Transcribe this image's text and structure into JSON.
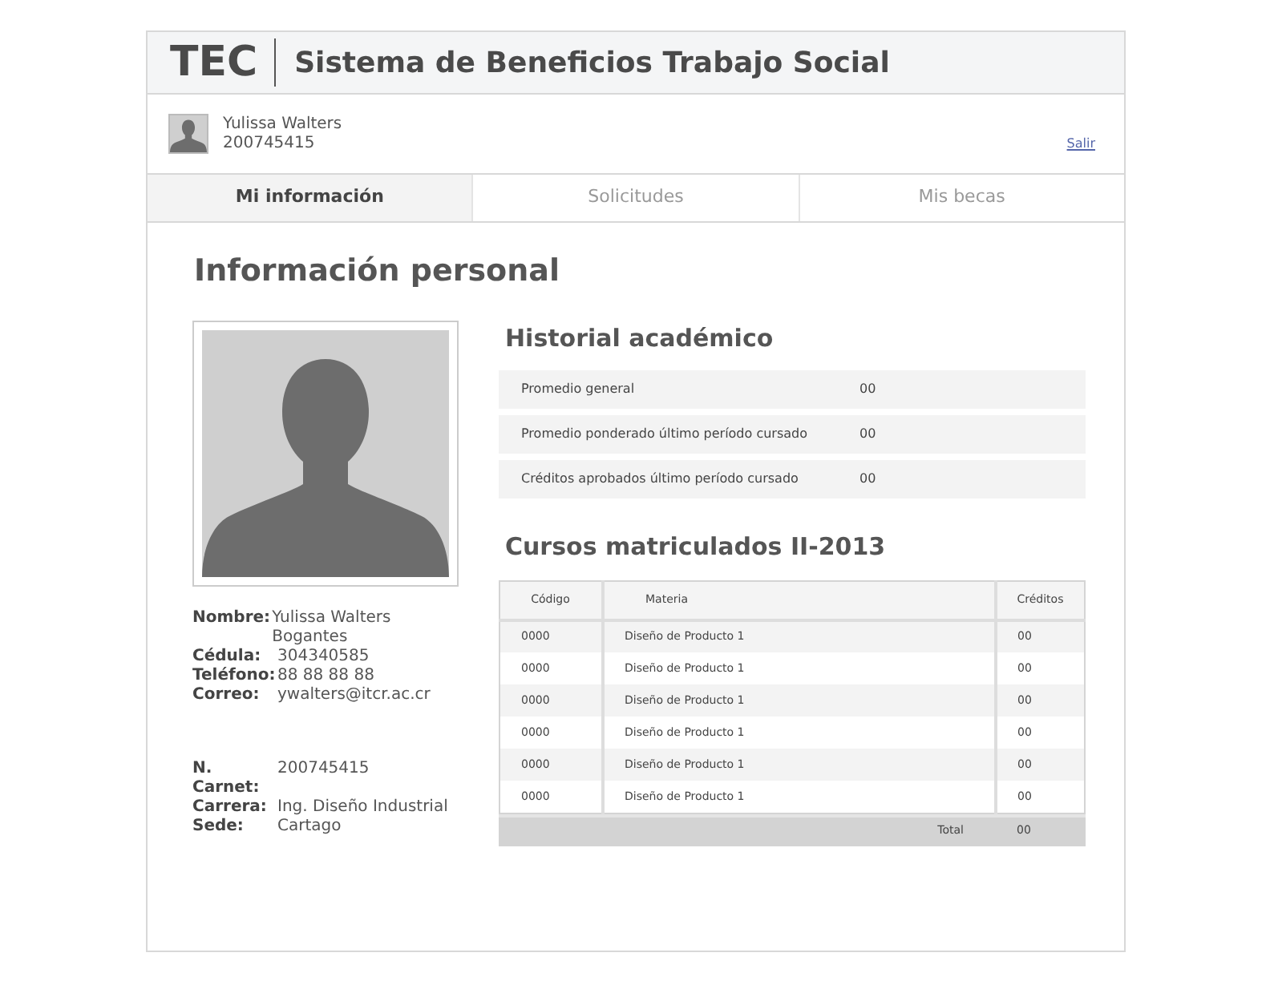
{
  "header": {
    "logo": "TEC",
    "title": "Sistema de Beneficios Trabajo Social"
  },
  "user": {
    "name": "Yulissa Walters",
    "id": "200745415",
    "logout": "Salir"
  },
  "tabs": [
    {
      "label": "Mi información",
      "selected": true
    },
    {
      "label": "Solicitudes",
      "selected": false
    },
    {
      "label": "Mis becas",
      "selected": false
    }
  ],
  "page_title": "Información personal",
  "profile": {
    "groups": [
      [
        {
          "label": "Nombre:",
          "value": "Yulissa Walters Bogantes"
        },
        {
          "label": "Cédula:",
          "value": "304340585"
        },
        {
          "label": "Teléfono:",
          "value": "88 88 88 88"
        },
        {
          "label": "Correo:",
          "value": "ywalters@itcr.ac.cr"
        }
      ],
      [
        {
          "label": "N. Carnet:",
          "value": "200745415"
        },
        {
          "label": "Carrera:",
          "value": "Ing. Diseño Industrial"
        },
        {
          "label": "Sede:",
          "value": "Cartago"
        }
      ]
    ]
  },
  "history": {
    "title": "Historial académico",
    "rows": [
      {
        "label": "Promedio general",
        "value": "00"
      },
      {
        "label": "Promedio ponderado último período cursado",
        "value": "00"
      },
      {
        "label": "Créditos aprobados último período cursado",
        "value": "00"
      }
    ]
  },
  "courses": {
    "title": "Cursos matriculados II-2013",
    "columns": [
      "Código",
      "Materia",
      "Créditos"
    ],
    "rows": [
      [
        "0000",
        "Diseño de Producto 1",
        "00"
      ],
      [
        "0000",
        "Diseño de Producto 1",
        "00"
      ],
      [
        "0000",
        "Diseño de Producto 1",
        "00"
      ],
      [
        "0000",
        "Diseño de Producto 1",
        "00"
      ],
      [
        "0000",
        "Diseño de Producto 1",
        "00"
      ],
      [
        "0000",
        "Diseño de Producto 1",
        "00"
      ]
    ],
    "total_label": "Total",
    "total_value": "00"
  }
}
